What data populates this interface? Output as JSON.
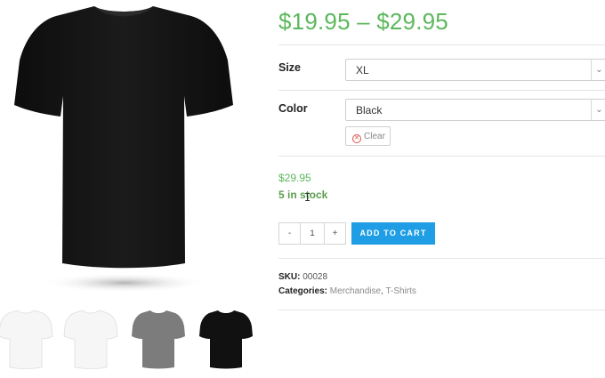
{
  "product": {
    "price_range": "$19.95 – $29.95",
    "variations": {
      "size_label": "Size",
      "size_value": "XL",
      "color_label": "Color",
      "color_value": "Black",
      "clear_label": "Clear"
    },
    "variation_price": "$29.95",
    "stock": "5 in stock",
    "quantity": {
      "minus_label": "-",
      "value": "1",
      "plus_label": "+"
    },
    "add_to_cart_label": "ADD TO CART",
    "meta": {
      "sku_label": "SKU:",
      "sku_value": "00028",
      "categories_label": "Categories:",
      "categories": [
        "Merchandise",
        "T-Shirts"
      ],
      "separator": ", "
    }
  },
  "gallery": {
    "main_image": "black-tshirt-image",
    "thumbnails": [
      {
        "name": "white-tshirt-thumb",
        "color": "#f4f4f4"
      },
      {
        "name": "white-tshirt-thumb",
        "color": "#f4f4f4"
      },
      {
        "name": "gray-tshirt-thumb",
        "color": "#7c7c7c"
      },
      {
        "name": "black-tshirt-thumb",
        "color": "#111111"
      }
    ]
  },
  "colors": {
    "price_green": "#5cb85c",
    "stock_green": "#5a9e4e",
    "button_blue": "#1f9ee6",
    "clear_red": "#d9534f"
  },
  "icons": {
    "dropdown": "chevron-down-icon",
    "clear": "close-circle-icon",
    "cursor": "text-cursor-icon"
  }
}
